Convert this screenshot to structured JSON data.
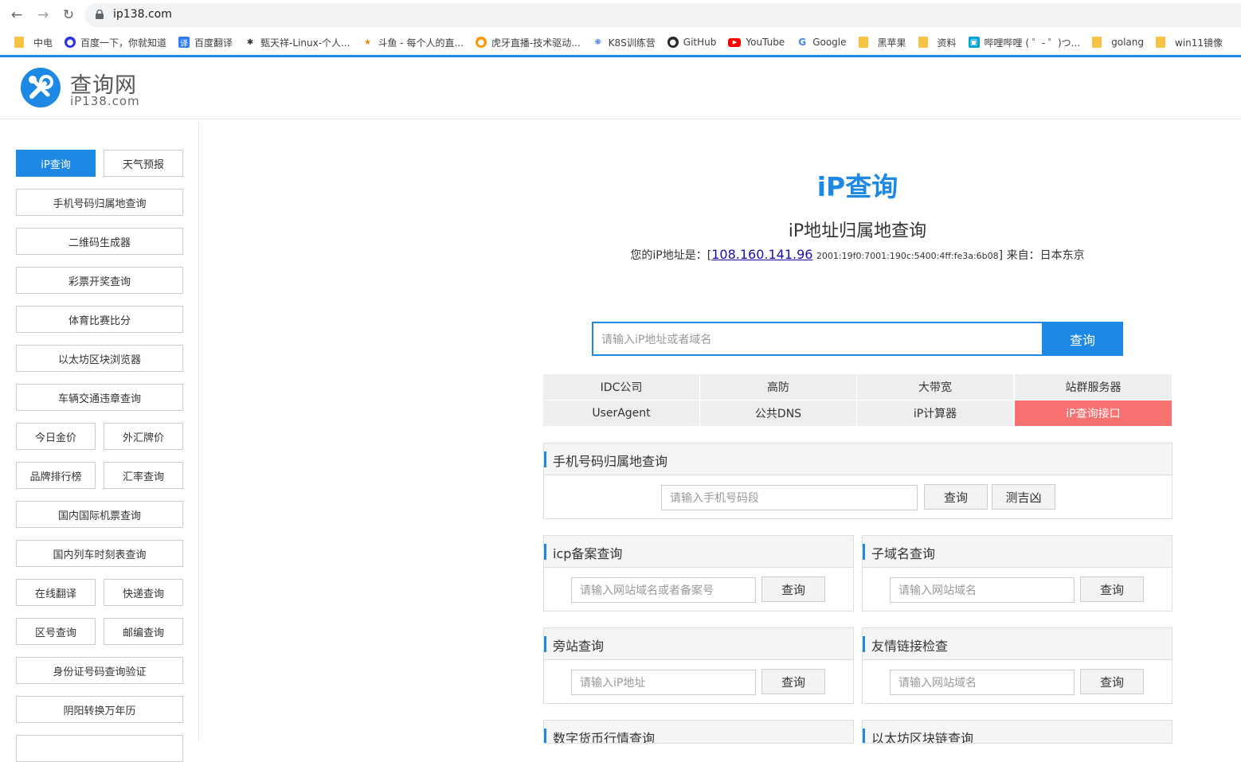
{
  "browser": {
    "url": "ip138.com",
    "bookmarks": [
      {
        "label": "中电",
        "icon": "folder-icon"
      },
      {
        "label": "百度一下，你就知道",
        "icon": "baidu-icon"
      },
      {
        "label": "百度翻译",
        "icon": "translate-icon"
      },
      {
        "label": "甄天祥-Linux-个人...",
        "icon": "blog-icon"
      },
      {
        "label": "斗鱼 - 每个人的直...",
        "icon": "douyu-icon"
      },
      {
        "label": "虎牙直播-技术驱动...",
        "icon": "huya-icon"
      },
      {
        "label": "K8S训练营",
        "icon": "k8s-icon"
      },
      {
        "label": "GitHub",
        "icon": "github-icon"
      },
      {
        "label": "YouTube",
        "icon": "youtube-icon"
      },
      {
        "label": "Google",
        "icon": "google-icon"
      },
      {
        "label": "黑苹果",
        "icon": "folder-icon"
      },
      {
        "label": "资料",
        "icon": "folder-icon"
      },
      {
        "label": "哔哩哔哩 ( ゜- ゜)つ...",
        "icon": "bilibili-icon"
      },
      {
        "label": "golang",
        "icon": "folder-icon"
      },
      {
        "label": "win11镜像",
        "icon": "folder-icon"
      }
    ]
  },
  "site": {
    "logo_title": "查询网",
    "logo_sub": "iP138.com"
  },
  "sidebar": {
    "items": [
      "iP查询",
      "天气预报",
      "手机号码归属地查询",
      "二维码生成器",
      "彩票开奖查询",
      "体育比赛比分",
      "以太坊区块浏览器",
      "车辆交通违章查询",
      "今日金价",
      "外汇牌价",
      "品牌排行榜",
      "汇率查询",
      "国内国际机票查询",
      "国内列车时刻表查询",
      "在线翻译",
      "快递查询",
      "区号查询",
      "邮编查询",
      "身份证号码查询验证",
      "阴阳转换万年历"
    ]
  },
  "main": {
    "title": "iP查询",
    "subtitle": "iP地址归属地查询",
    "ip_prefix": "您的iP地址是：[",
    "ip_v4": "108.160.141.96",
    "ip_v6": "2001:19f0:7001:190c:5400:4ff:fe3a:6b08",
    "ip_suffix": "] 来自：日本东京",
    "search_placeholder": "请输入iP地址或者域名",
    "search_button": "查询",
    "quick_links": [
      "IDC公司",
      "高防",
      "大带宽",
      "站群服务器",
      "UserAgent",
      "公共DNS",
      "iP计算器",
      "iP查询接口"
    ]
  },
  "panels": {
    "phone": {
      "title": "手机号码归属地查询",
      "placeholder": "请输入手机号码段",
      "btn1": "查询",
      "btn2": "测吉凶"
    },
    "icp": {
      "title": "icp备案查询",
      "placeholder": "请输入网站域名或者备案号",
      "btn": "查询"
    },
    "subdomain": {
      "title": "子域名查询",
      "placeholder": "请输入网站域名",
      "btn": "查询"
    },
    "sidesite": {
      "title": "旁站查询",
      "placeholder": "请输入iP地址",
      "btn": "查询"
    },
    "friendlink": {
      "title": "友情链接检查",
      "placeholder": "请输入网站域名",
      "btn": "查询"
    },
    "crypto": {
      "title": "数字货币行情查询"
    },
    "eth": {
      "title": "以太坊区块链查询"
    }
  }
}
